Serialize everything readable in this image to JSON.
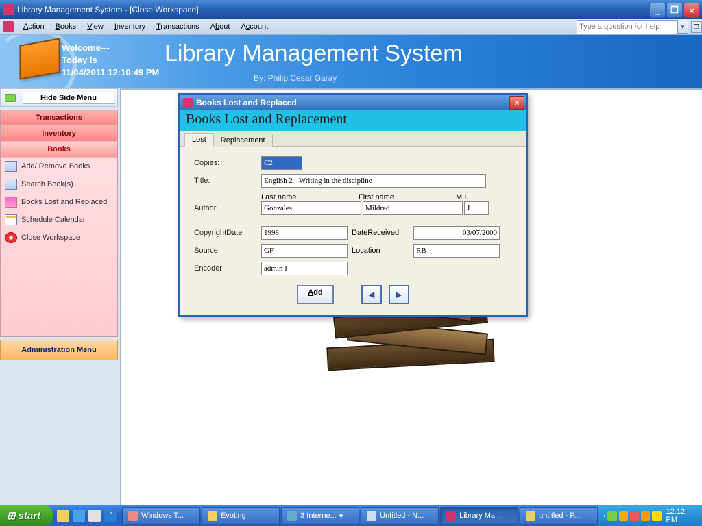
{
  "window": {
    "title": "Library Management System - [Close Workspace]"
  },
  "menu": {
    "items": [
      "Action",
      "Books",
      "View",
      "Inventory",
      "Transactions",
      "About",
      "Account"
    ],
    "help_placeholder": "Type a question for help"
  },
  "header": {
    "welcome": "Welcome---",
    "today": "Today is",
    "datetime": "11/04/2011 12:10:49 PM",
    "app_title": "Library Management System",
    "byline": "By: Philip Cesar Garay"
  },
  "sidebar": {
    "hide_label": "Hide Side Menu",
    "sections": {
      "transactions": "Transactions",
      "inventory": "Inventory",
      "books": "Books"
    },
    "items": {
      "add_remove": "Add/ Remove Books",
      "search": "Search Book(s)",
      "lost": "Books Lost and Replaced",
      "calendar": "Schedule Calendar",
      "close": "Close Workspace"
    },
    "admin": "Administration Menu"
  },
  "dialog": {
    "title": "Books Lost and Replaced",
    "subtitle": "Books Lost and Replacement",
    "tabs": {
      "lost": "Lost",
      "replacement": "Replacement"
    },
    "labels": {
      "copies": "Copies:",
      "title": "Title:",
      "author": "Author",
      "last": "Last name",
      "first": "First name",
      "mi": "M.I.",
      "copyright": "CopyrightDate",
      "received": "DateReceived",
      "source": "Source",
      "location": "Location",
      "encoder": "Encoder:"
    },
    "values": {
      "copies": "C2",
      "title": "English 2 - Writing in the discipline",
      "last": "Gonzales",
      "first": "Mildred",
      "mi": "J.",
      "copyright": "1998",
      "received": "03/07/2000",
      "source": "GF",
      "location": "RB",
      "encoder": "admin I"
    },
    "buttons": {
      "add": "Add"
    }
  },
  "taskbar": {
    "start": "start",
    "buttons": [
      "Windows T...",
      "Evoting",
      "3 Interne...",
      "Untitled - N...",
      "Library Ma...",
      "untitled - P..."
    ],
    "clock": "12:12 PM"
  }
}
